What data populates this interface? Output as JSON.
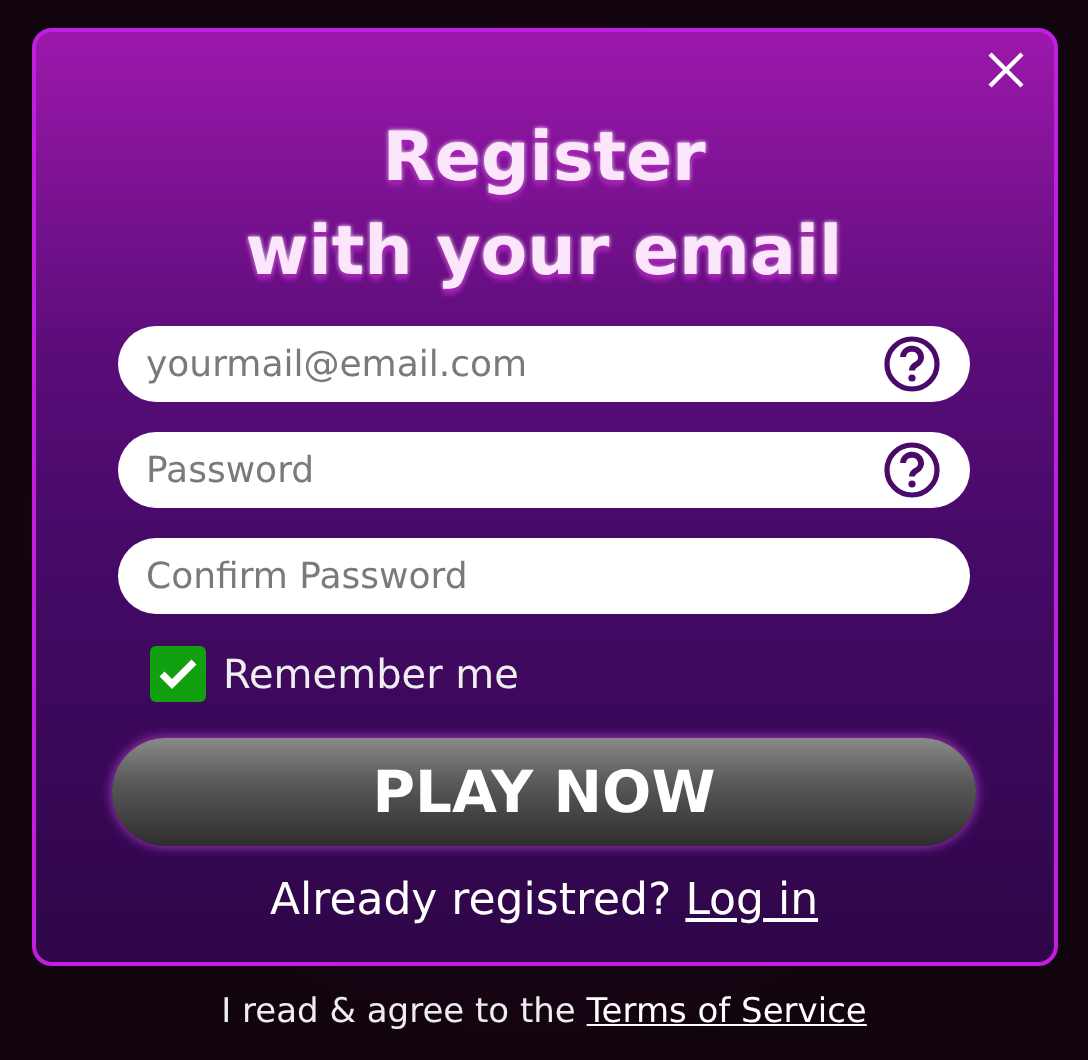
{
  "dialog": {
    "title_lines": [
      "Register",
      "with your email"
    ]
  },
  "fields": [
    {
      "placeholder": "yourmail@email.com",
      "help": true
    },
    {
      "placeholder": "Password",
      "help": true
    },
    {
      "placeholder": "Confirm Password",
      "help": false
    }
  ],
  "remember": {
    "label": "Remember me",
    "checked": true
  },
  "button": "PLAY NOW",
  "login": {
    "text": "Already registred?",
    "link": "Log in"
  },
  "terms": {
    "text": "I read & agree to the",
    "link": "Terms of Service"
  }
}
